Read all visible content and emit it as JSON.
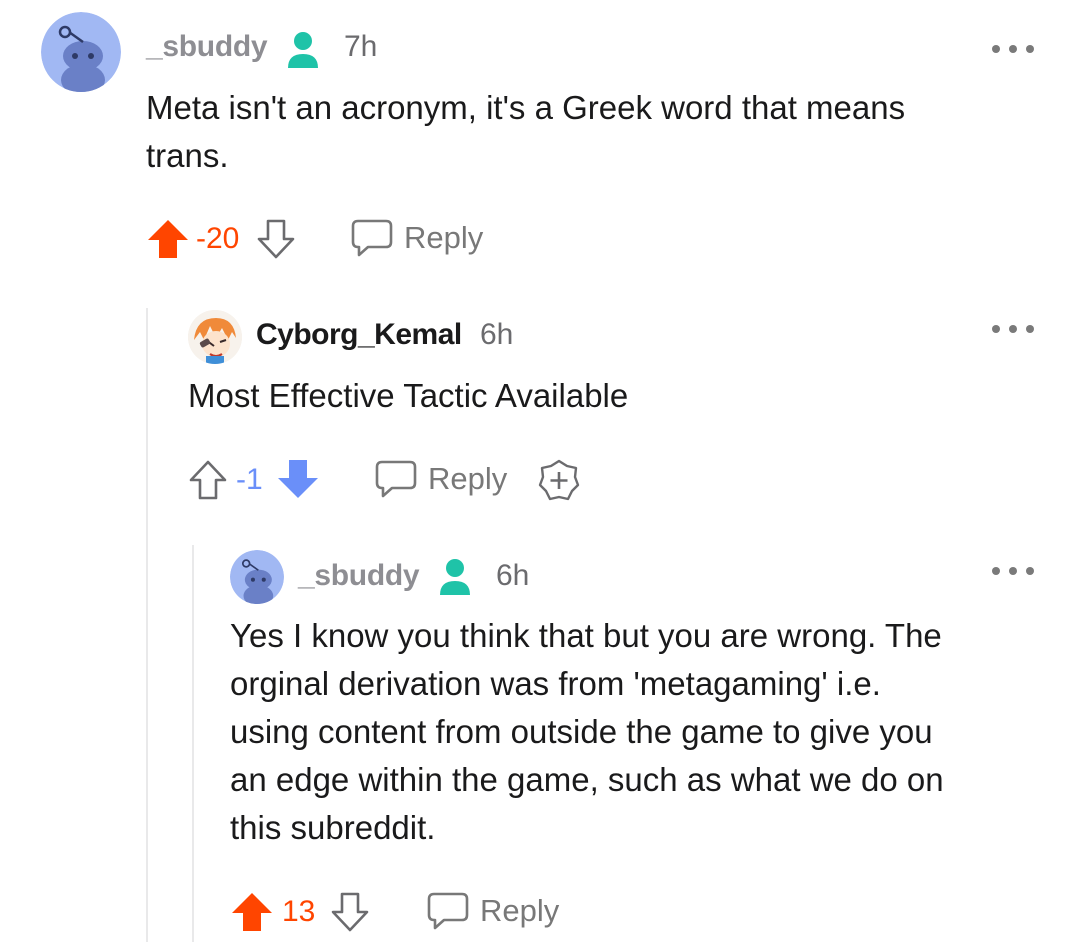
{
  "comments": [
    {
      "username": "_sbuddy",
      "flair_icon": "person-flair-icon",
      "time": "7h",
      "text": "Meta isn't an acronym, it's a Greek word that means\ntrans.",
      "score": "-20",
      "vote_state": "upvoted",
      "reply_label": "Reply"
    },
    {
      "username": "Cyborg_Kemal",
      "time": "6h",
      "text": "Most Effective Tactic Available",
      "score": "-1",
      "vote_state": "downvoted",
      "reply_label": "Reply",
      "award_icon": "award-plus-icon"
    },
    {
      "username": "_sbuddy",
      "flair_icon": "person-flair-icon",
      "time": "6h",
      "text": "Yes I know you think that but you are wrong. The\norginal derivation was from 'metagaming' i.e.\nusing content from outside the game to give you\nan edge within the game, such as what we do on\nthis subreddit.",
      "score": "13",
      "vote_state": "upvoted",
      "reply_label": "Reply"
    }
  ],
  "colors": {
    "upvote": "#ff4500",
    "downvote": "#6a8ff9",
    "flair": "#1fc3a8",
    "avatar_bg": "#a1b8f3"
  }
}
